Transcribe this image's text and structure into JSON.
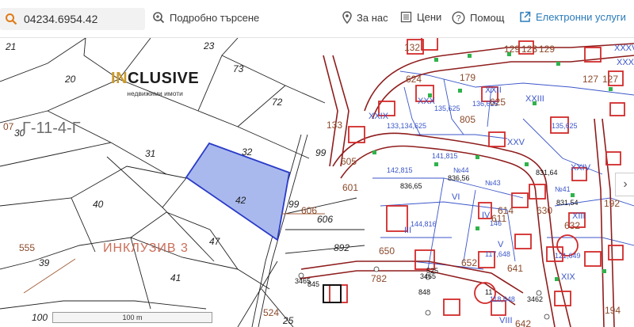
{
  "search": {
    "value": "04234.6954.42"
  },
  "toolbar": {
    "advanced_search": "Подробно търсене",
    "about": "За нас",
    "prices": "Цени",
    "help": "Помощ",
    "e_services": "Електронни услуги"
  },
  "colors": {
    "accent": "#2b7bb9",
    "selected_fill": "#a9b9ee",
    "selected_stroke": "#2a3bc8",
    "parcel_red": "#d12a2a",
    "label_brown": "#8b4a2b"
  },
  "logo": {
    "text_pre": "I",
    "text_mid": "N",
    "text_post": "CLUSIVE",
    "subtitle": "недвижими имоти"
  },
  "watermark": "ИНКЛУЗИВ 3",
  "scale_label": "100 m",
  "selected_parcel": "42",
  "map_labels": {
    "left": [
      "21",
      "23",
      "20",
      "73",
      "72",
      "Г-11-4-Г",
      "30",
      "31",
      "32",
      "40",
      "42",
      "47",
      "39",
      "41",
      "555",
      "100",
      "99",
      "606",
      "892",
      "524",
      "25",
      "07"
    ],
    "right": [
      "132",
      "624",
      "179",
      "133",
      "605",
      "625",
      "601",
      "650",
      "614",
      "XXX",
      "XXXI",
      "XXVI",
      "XXIV",
      "III",
      "VI",
      "V",
      "IV",
      "XXII",
      "XIX",
      "641",
      "611",
      "630",
      "632",
      "652",
      "652",
      "782",
      "642",
      "194",
      "192",
      "XX",
      "XXIX"
    ],
    "addresses": [
      "133,134,625",
      "135,625",
      "136,625",
      "135,625",
      "142,815",
      "144,816",
      "121,649",
      "118,648",
      "140"
    ],
    "house_numbers": [
      "3465",
      "3465",
      "3462",
      "846"
    ]
  }
}
